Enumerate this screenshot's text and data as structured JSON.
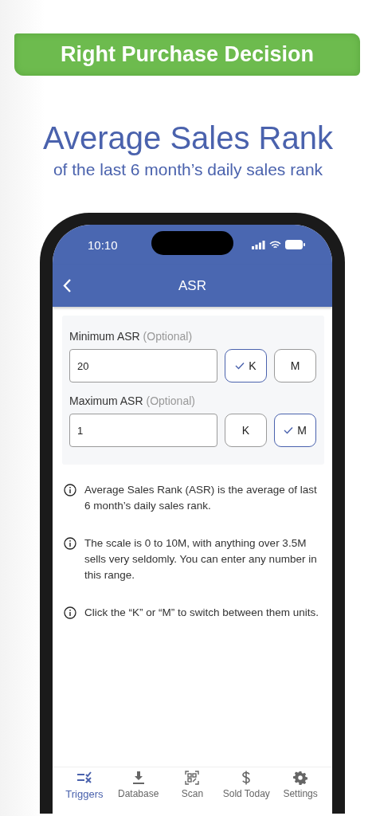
{
  "banner": {
    "text": "Right Purchase Decision"
  },
  "headline": {
    "title": "Average Sales Rank",
    "subtitle": "of the last 6 month’s daily sales rank"
  },
  "status_bar": {
    "time": "10:10"
  },
  "nav": {
    "title": "ASR"
  },
  "fields": [
    {
      "label": "Minimum ASR",
      "hint": "(Optional)",
      "value": "20",
      "units": [
        {
          "label": "K",
          "selected": true
        },
        {
          "label": "M",
          "selected": false
        }
      ]
    },
    {
      "label": "Maximum ASR",
      "hint": "(Optional)",
      "value": "1",
      "units": [
        {
          "label": "K",
          "selected": false
        },
        {
          "label": "M",
          "selected": true
        }
      ]
    }
  ],
  "info": [
    "Average Sales Rank (ASR) is the average of last 6 month’s daily sales rank.",
    "The scale is 0 to 10M, with anything over 3.5M sells very seldomly. You can enter any number in this range.",
    "Click the “K” or “M” to switch between them units."
  ],
  "tab_bar": [
    {
      "label": "Triggers",
      "kind": "triggers",
      "selected": true
    },
    {
      "label": "Database",
      "kind": "download",
      "selected": false
    },
    {
      "label": "Scan",
      "kind": "scan",
      "selected": false
    },
    {
      "label": "Sold Today",
      "kind": "dollar",
      "selected": false
    },
    {
      "label": "Settings",
      "kind": "settings",
      "selected": false
    }
  ]
}
